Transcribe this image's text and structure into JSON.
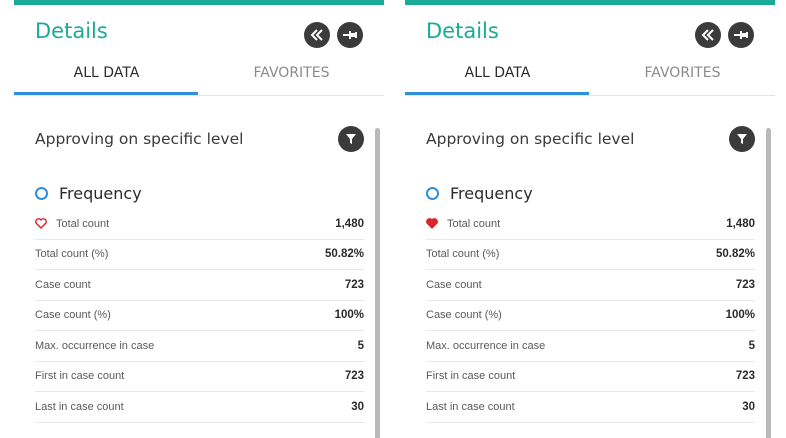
{
  "panels": [
    {
      "title": "Details",
      "tabs": {
        "all": "ALL DATA",
        "favorites": "FAVORITES"
      },
      "section_title": "Approving on specific level",
      "group_label": "Frequency",
      "favorite_filled": false,
      "rows": [
        {
          "label": "Total count",
          "value": "1,480"
        },
        {
          "label": "Total count (%)",
          "value": "50.82%"
        },
        {
          "label": "Case count",
          "value": "723"
        },
        {
          "label": "Case count (%)",
          "value": "100%"
        },
        {
          "label": "Max. occurrence in case",
          "value": "5"
        },
        {
          "label": "First in case count",
          "value": "723"
        },
        {
          "label": "Last in case count",
          "value": "30"
        }
      ]
    },
    {
      "title": "Details",
      "tabs": {
        "all": "ALL DATA",
        "favorites": "FAVORITES"
      },
      "section_title": "Approving on specific level",
      "group_label": "Frequency",
      "favorite_filled": true,
      "rows": [
        {
          "label": "Total count",
          "value": "1,480"
        },
        {
          "label": "Total count (%)",
          "value": "50.82%"
        },
        {
          "label": "Case count",
          "value": "723"
        },
        {
          "label": "Case count (%)",
          "value": "100%"
        },
        {
          "label": "Max. occurrence in case",
          "value": "5"
        },
        {
          "label": "First in case count",
          "value": "723"
        },
        {
          "label": "Last in case count",
          "value": "30"
        }
      ]
    }
  ],
  "icons": {
    "collapse": "double-chevron-left-icon",
    "pin": "pin-icon",
    "filter": "filter-icon",
    "favorite": "heart-icon"
  },
  "colors": {
    "accent": "#1aab96",
    "tab_underline": "#2f8fd8",
    "heart": "#d9262c",
    "button_bg": "#3b3b3b"
  }
}
